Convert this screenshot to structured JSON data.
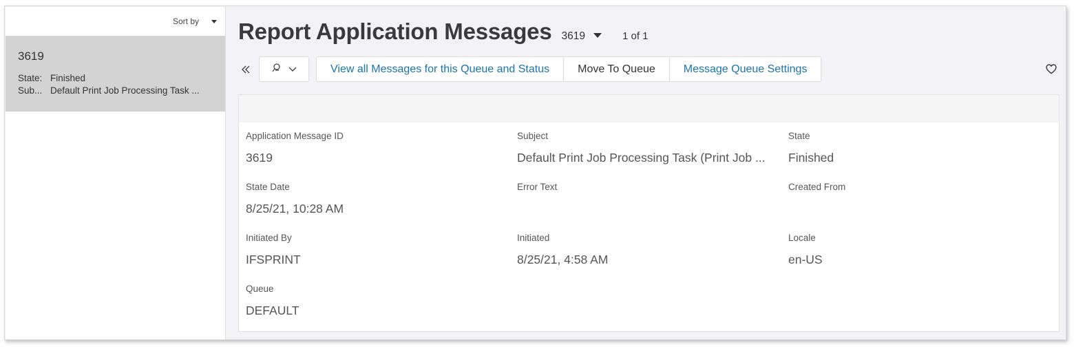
{
  "sidebar": {
    "sort_label": "Sort by",
    "items": [
      {
        "id": "3619",
        "state_key": "State:",
        "state_val": "Finished",
        "subject_key": "Sub...",
        "subject_val": "Default Print Job Processing Task ..."
      }
    ]
  },
  "header": {
    "title": "Report Application Messages",
    "record_id": "3619",
    "pager": "1 of 1"
  },
  "toolbar": {
    "commands": [
      "View all Messages for this Queue and Status",
      "Move To Queue",
      "Message Queue Settings"
    ]
  },
  "details": {
    "app_msg_id_label": "Application Message ID",
    "app_msg_id": "3619",
    "subject_label": "Subject",
    "subject": "Default Print Job Processing Task (Print Job ...",
    "state_label": "State",
    "state": "Finished",
    "state_date_label": "State Date",
    "state_date": "8/25/21, 10:28 AM",
    "error_text_label": "Error Text",
    "error_text": "",
    "created_from_label": "Created From",
    "created_from": "",
    "initiated_by_label": "Initiated By",
    "initiated_by": "IFSPRINT",
    "initiated_label": "Initiated",
    "initiated": "8/25/21, 4:58 AM",
    "locale_label": "Locale",
    "locale": "en-US",
    "queue_label": "Queue",
    "queue": "DEFAULT"
  },
  "colors": {
    "link": "#1b75ad",
    "selected_row": "#d3d3d3",
    "background": "#f3f2f5"
  },
  "icons": {
    "collapse": "double-chevron-left-icon",
    "pin": "pin-icon",
    "dropdown": "chevron-down-icon",
    "favorite": "heart-icon"
  }
}
